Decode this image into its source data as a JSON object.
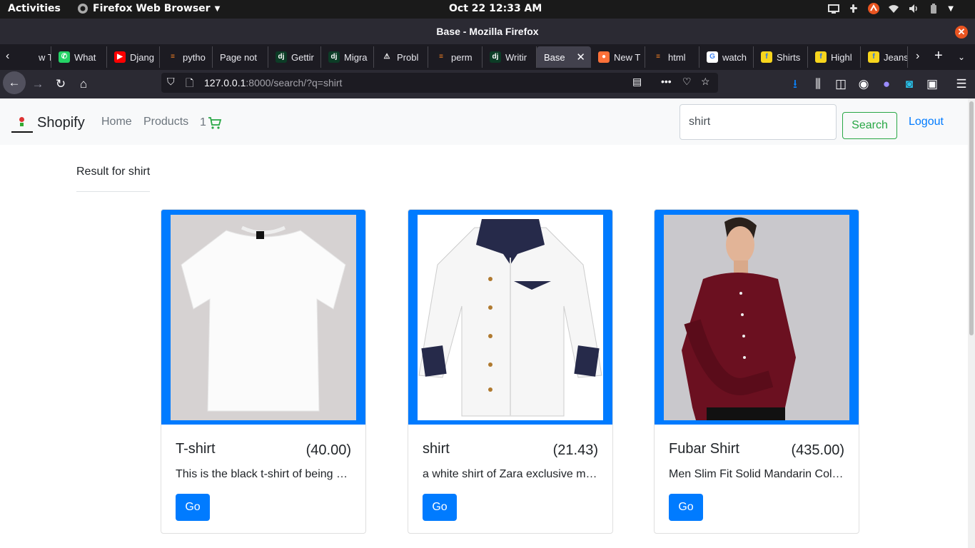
{
  "system_bar": {
    "activities": "Activities",
    "app_name": "Firefox Web Browser",
    "clock": "Oct 22  12:33 AM"
  },
  "window": {
    "title": "Base - Mozilla Firefox"
  },
  "tabs": [
    {
      "label": "w T",
      "icon": "partial-tab-icon"
    },
    {
      "label": "What",
      "icon": "whatsapp-icon"
    },
    {
      "label": "Djang",
      "icon": "youtube-icon"
    },
    {
      "label": "pytho",
      "icon": "stackoverflow-icon"
    },
    {
      "label": "Page not",
      "icon": ""
    },
    {
      "label": "Gettir",
      "icon": "django-icon"
    },
    {
      "label": "Migra",
      "icon": "django-icon"
    },
    {
      "label": "Probl",
      "icon": "warning-icon"
    },
    {
      "label": "perm",
      "icon": "stackoverflow-icon"
    },
    {
      "label": "Writir",
      "icon": "django-icon"
    },
    {
      "label": "Base",
      "icon": "",
      "active": true
    },
    {
      "label": "New T",
      "icon": "firefox-icon"
    },
    {
      "label": "html",
      "icon": "stackoverflow-icon"
    },
    {
      "label": "watch",
      "icon": "google-icon"
    },
    {
      "label": "Shirts",
      "icon": "flipkart-icon"
    },
    {
      "label": "Highl",
      "icon": "flipkart-icon"
    },
    {
      "label": "Jeans",
      "icon": "flipkart-icon"
    }
  ],
  "url": {
    "host": "127.0.0.1",
    "path": ":8000/search/?q=shirt"
  },
  "site": {
    "brand": "Shopify",
    "nav_home": "Home",
    "nav_products": "Products",
    "cart_count": "1",
    "search_value": "shirt",
    "search_button": "Search",
    "logout": "Logout",
    "result_title": "Result for shirt"
  },
  "products": [
    {
      "name": "T-shirt",
      "price": "(40.00)",
      "desc": "This is the black t-shirt of being …",
      "button": "Go"
    },
    {
      "name": "shirt",
      "price": "(21.43)",
      "desc": "a white shirt of Zara exclusive m…",
      "button": "Go"
    },
    {
      "name": "Fubar Shirt",
      "price": "(435.00)",
      "desc": "Men Slim Fit Solid Mandarin Col…",
      "button": "Go"
    }
  ],
  "colors": {
    "primary": "#007bff",
    "success": "#28a745",
    "navbar_bg": "#f8f9fa",
    "browser_chrome": "#2b2a33"
  }
}
